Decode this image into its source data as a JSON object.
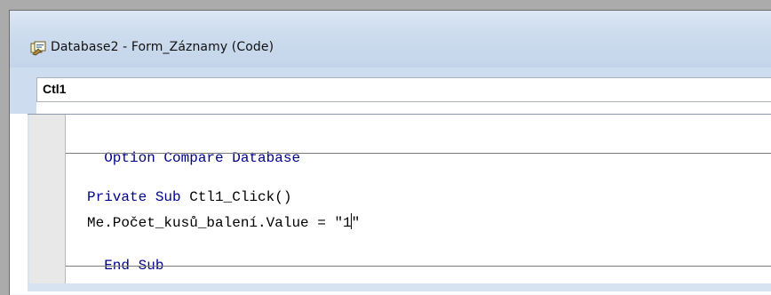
{
  "window": {
    "title": "Database2 - Form_Záznamy (Code)",
    "icon": "vba-code-module-icon"
  },
  "object_dropdown": {
    "value": "Ctl1"
  },
  "code": {
    "line1": {
      "kw": "Option Compare Database"
    },
    "line2": {
      "kw1": "Private Sub",
      "tx": " Ctl1_Click()"
    },
    "line3": {
      "before_caret": "Me.Počet_kusů_balení.Value = \"1",
      "after_caret": "\""
    },
    "line4": {
      "kw": "End Sub"
    }
  },
  "colors": {
    "keyword": "#00008b",
    "titlebar": "#cddcee"
  }
}
